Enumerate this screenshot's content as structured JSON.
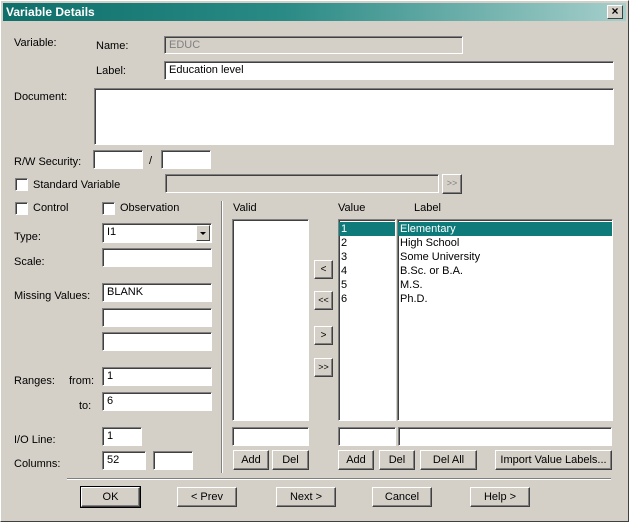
{
  "window": {
    "title": "Variable Details",
    "close_glyph": "×"
  },
  "variable": {
    "section_label": "Variable:",
    "name_label": "Name:",
    "name_value": "EDUC",
    "label_label": "Label:",
    "label_value": "Education level"
  },
  "document": {
    "label": "Document:",
    "value": ""
  },
  "security": {
    "label": "R/W Security:",
    "read": "",
    "sep": "/",
    "write": ""
  },
  "standard_variable": {
    "label": "Standard Variable",
    "checked": false,
    "value": "",
    "button": ">>"
  },
  "options": {
    "control_label": "Control",
    "control_checked": false,
    "observation_label": "Observation",
    "observation_checked": false
  },
  "type": {
    "label": "Type:",
    "value": "I1"
  },
  "scale": {
    "label": "Scale:",
    "value": ""
  },
  "missing": {
    "label": "Missing Values:",
    "values": [
      "BLANK",
      "",
      ""
    ]
  },
  "ranges": {
    "label": "Ranges:",
    "from_label": "from:",
    "from": "1",
    "to_label": "to:",
    "to": "6"
  },
  "io": {
    "line_label": "I/O  Line:",
    "line": "1",
    "columns_label": "Columns:",
    "columns": "52",
    "columns2": ""
  },
  "valid": {
    "header": "Valid",
    "items": [],
    "input": "",
    "add": "Add",
    "del": "Del"
  },
  "move_buttons": {
    "left": "<",
    "all_left": "<<",
    "right": ">",
    "all_right": ">>"
  },
  "values_table": {
    "value_header": "Value",
    "label_header": "Label",
    "rows": [
      {
        "value": "1",
        "label": "Elementary",
        "selected": true
      },
      {
        "value": "2",
        "label": "High School",
        "selected": false
      },
      {
        "value": "3",
        "label": "Some University",
        "selected": false
      },
      {
        "value": "4",
        "label": "B.Sc. or B.A.",
        "selected": false
      },
      {
        "value": "5",
        "label": "M.S.",
        "selected": false
      },
      {
        "value": "6",
        "label": "Ph.D.",
        "selected": false
      }
    ],
    "value_input": "",
    "label_input": "",
    "add": "Add",
    "del": "Del",
    "del_all": "Del All",
    "import": "Import Value Labels..."
  },
  "footer": {
    "ok": "OK",
    "prev": "< Prev",
    "next": "Next >",
    "cancel": "Cancel",
    "help": "Help >"
  },
  "colors": {
    "title_bar": "#0f6f6a",
    "selection": "#0f7a7a",
    "face": "#d4d0c8"
  }
}
